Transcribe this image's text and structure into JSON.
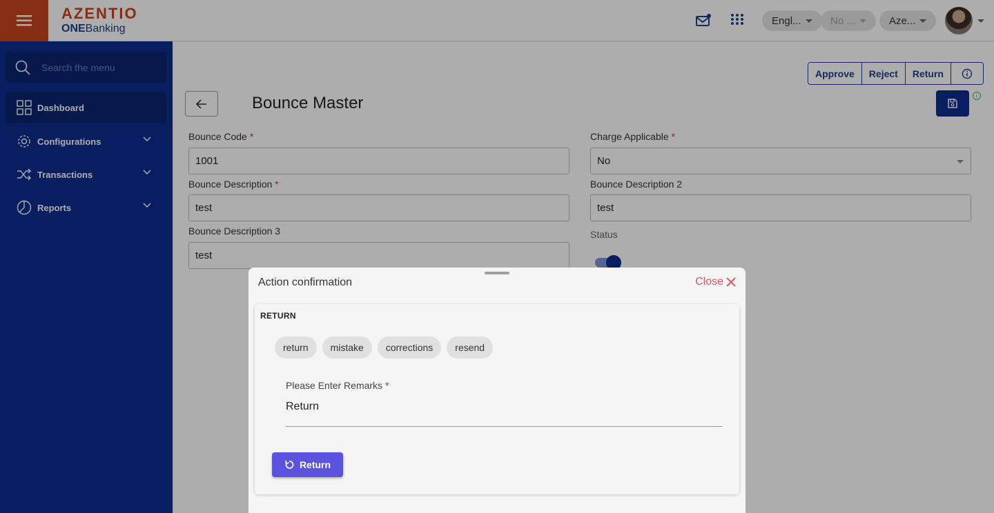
{
  "header": {
    "logo_top": "AZENTIO",
    "logo_bottom_bold": "ONE",
    "logo_bottom_rest": "Banking",
    "language": "Engl...",
    "branch": "No ...",
    "entity": "Aze..."
  },
  "sidebar": {
    "search_placeholder": "Search the menu",
    "items": [
      {
        "label": "Dashboard",
        "icon": "grid-icon"
      },
      {
        "label": "Configurations",
        "icon": "gear-icon"
      },
      {
        "label": "Transactions",
        "icon": "shuffle-icon"
      },
      {
        "label": "Reports",
        "icon": "pie-chart-icon"
      }
    ]
  },
  "page": {
    "title": "Bounce Master",
    "actions": [
      "Approve",
      "Reject",
      "Return"
    ],
    "fields": {
      "bounce_code": {
        "label": "Bounce Code",
        "value": "1001"
      },
      "charge_applicable": {
        "label": "Charge Applicable",
        "value": "No"
      },
      "bounce_description": {
        "label": "Bounce Description",
        "value": "test"
      },
      "bounce_description_2": {
        "label": "Bounce Description 2",
        "value": "test"
      },
      "bounce_description_3": {
        "label": "Bounce Description 3",
        "value": "test"
      },
      "status": {
        "label": "Status",
        "on": true
      }
    },
    "required_mark": "*"
  },
  "dialog": {
    "title": "Action confirmation",
    "close_label": "Close",
    "section": "RETURN",
    "chips": [
      "return",
      "mistake",
      "corrections",
      "resend"
    ],
    "remarks_label": "Please Enter Remarks",
    "remarks_value": "Return",
    "submit_label": "Return"
  },
  "colors": {
    "brand_orange": "#c8431a",
    "brand_navy": "#0d2d8f",
    "accent_purple": "#5b52e0",
    "close_red": "#e25566"
  }
}
